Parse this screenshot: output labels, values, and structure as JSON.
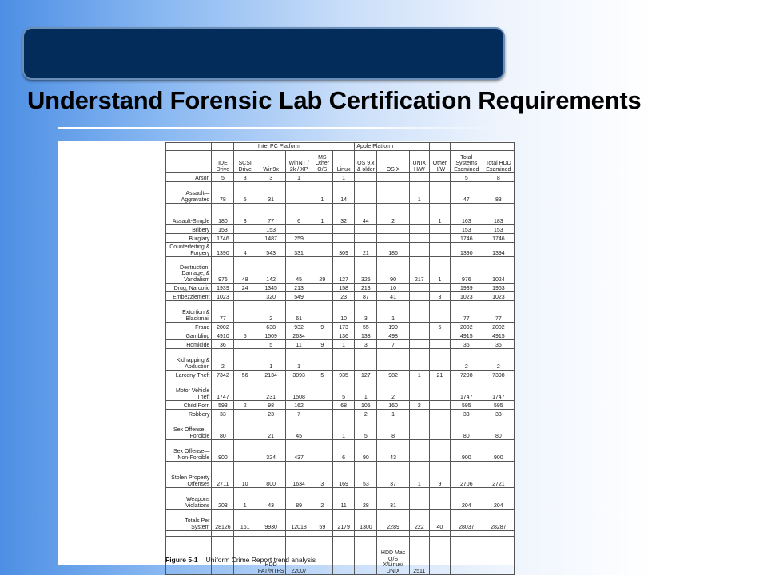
{
  "slide": {
    "title": "Understand Forensic Lab Certification Requirements"
  },
  "table": {
    "group_headers": [
      "Intel PC Platform",
      "Apple Platform"
    ],
    "columns": [
      "IDE Drive",
      "SCSI Drive",
      "Win9x",
      "WinNT / 2k / XP",
      "MS Other O/S",
      "Linux",
      "OS 9.x & older",
      "OS X",
      "UNIX H/W",
      "Other H/W",
      "Total Systems Examined",
      "Total HDD Examined"
    ],
    "rows": [
      {
        "category": "Arson",
        "values": [
          "5",
          "3",
          "3",
          "1",
          "",
          "1",
          "",
          "",
          "",
          "",
          "5",
          "8"
        ]
      },
      {
        "category": "Assault—Aggravated",
        "values": [
          "78",
          "5",
          "31",
          "",
          "1",
          "14",
          "",
          "",
          "1",
          "",
          "47",
          "83"
        ]
      },
      {
        "category": "Assault-Simple",
        "values": [
          "180",
          "3",
          "77",
          "6",
          "1",
          "32",
          "44",
          "2",
          "",
          "1",
          "163",
          "183"
        ]
      },
      {
        "category": "Bribery",
        "values": [
          "153",
          "",
          "153",
          "",
          "",
          "",
          "",
          "",
          "",
          "",
          "153",
          "153"
        ]
      },
      {
        "category": "Burglary",
        "values": [
          "1746",
          "",
          "1487",
          "259",
          "",
          "",
          "",
          "",
          "",
          "",
          "1746",
          "1746"
        ]
      },
      {
        "category": "Counterfeiting & Forgery",
        "values": [
          "1390",
          "4",
          "543",
          "331",
          "",
          "309",
          "21",
          "186",
          "",
          "",
          "1390",
          "1394"
        ]
      },
      {
        "category": "Destruction, Damage, & Vandalism",
        "values": [
          "976",
          "48",
          "142",
          "45",
          "29",
          "127",
          "325",
          "90",
          "217",
          "1",
          "976",
          "1024"
        ]
      },
      {
        "category": "Drug, Narcotic",
        "values": [
          "1939",
          "24",
          "1345",
          "213",
          "",
          "158",
          "213",
          "10",
          "",
          "",
          "1939",
          "1963"
        ]
      },
      {
        "category": "Embezzlement",
        "values": [
          "1023",
          "",
          "320",
          "549",
          "",
          "23",
          "87",
          "41",
          "",
          "3",
          "1023",
          "1023"
        ]
      },
      {
        "category": "Extortion & Blackmail",
        "values": [
          "77",
          "",
          "2",
          "61",
          "",
          "10",
          "3",
          "1",
          "",
          "",
          "77",
          "77"
        ]
      },
      {
        "category": "Fraud",
        "values": [
          "2002",
          "",
          "638",
          "932",
          "9",
          "173",
          "55",
          "190",
          "",
          "5",
          "2002",
          "2002"
        ]
      },
      {
        "category": "Gambling",
        "values": [
          "4910",
          "5",
          "1509",
          "2634",
          "",
          "136",
          "138",
          "498",
          "",
          "",
          "4915",
          "4915"
        ]
      },
      {
        "category": "Homicide",
        "values": [
          "36",
          "",
          "5",
          "11",
          "9",
          "1",
          "3",
          "7",
          "",
          "",
          "36",
          "36"
        ]
      },
      {
        "category": "Kidnapping & Abduction",
        "values": [
          "2",
          "",
          "1",
          "1",
          "",
          "",
          "",
          "",
          "",
          "",
          "2",
          "2"
        ]
      },
      {
        "category": "Larceny Theft",
        "values": [
          "7342",
          "56",
          "2134",
          "3093",
          "5",
          "935",
          "127",
          "982",
          "1",
          "21",
          "7298",
          "7398"
        ]
      },
      {
        "category": "Motor Vehicle Theft",
        "values": [
          "1747",
          "",
          "231",
          "1508",
          "",
          "5",
          "1",
          "2",
          "",
          "",
          "1747",
          "1747"
        ]
      },
      {
        "category": "Child Porn",
        "values": [
          "593",
          "2",
          "98",
          "162",
          "",
          "68",
          "105",
          "160",
          "2",
          "",
          "595",
          "595"
        ]
      },
      {
        "category": "Robbery",
        "values": [
          "33",
          "",
          "23",
          "7",
          "",
          "",
          "2",
          "1",
          "",
          "",
          "33",
          "33"
        ]
      },
      {
        "category": "Sex Offense—Forcible",
        "values": [
          "80",
          "",
          "21",
          "45",
          "",
          "1",
          "5",
          "8",
          "",
          "",
          "80",
          "80"
        ]
      },
      {
        "category": "Sex Offense—Non-Forcible",
        "values": [
          "900",
          "",
          "324",
          "437",
          "",
          "6",
          "90",
          "43",
          "",
          "",
          "900",
          "900"
        ]
      },
      {
        "category": "Stolen Property Offenses",
        "values": [
          "2711",
          "10",
          "800",
          "1634",
          "3",
          "169",
          "53",
          "37",
          "1",
          "9",
          "2706",
          "2721"
        ]
      },
      {
        "category": "Weapons Violations",
        "values": [
          "203",
          "1",
          "43",
          "89",
          "2",
          "11",
          "28",
          "31",
          "",
          "",
          "204",
          "204"
        ]
      },
      {
        "category": "Totals Per System",
        "values": [
          "28126",
          "161",
          "9930",
          "12018",
          "59",
          "2179",
          "1300",
          "2289",
          "222",
          "40",
          "28037",
          "28287"
        ]
      }
    ],
    "hdd_row": {
      "win_label": "HDD FAT/NTFS",
      "win_value": "22007",
      "mac_label": "HDD Mac O/S X/Linux/ UNIX",
      "mac_value": "2511"
    }
  },
  "figure": {
    "number": "Figure 5-1",
    "caption": "Uniform Crime Report trend analysis"
  }
}
